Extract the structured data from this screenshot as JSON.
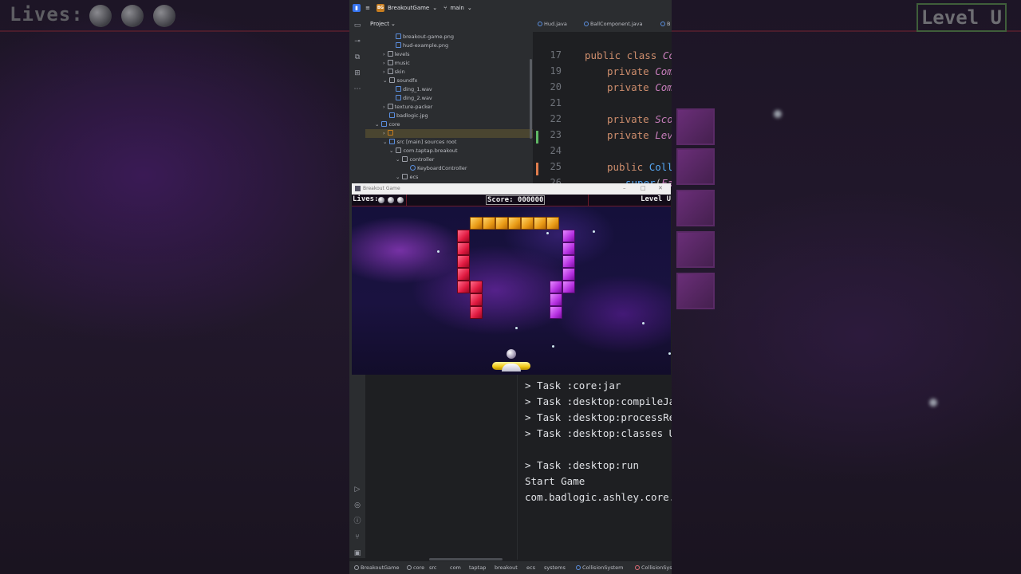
{
  "background": {
    "lives_label": "Lives:",
    "level_label": "Level U"
  },
  "ide": {
    "project_name": "BreakoutGame",
    "project_badge": "BG",
    "branch": "main",
    "project_panel_title": "Project",
    "tree": [
      {
        "label": "breakout-game.png",
        "kind": "file"
      },
      {
        "label": "hud-example.png",
        "kind": "file"
      },
      {
        "label": "levels",
        "kind": "folder"
      },
      {
        "label": "music",
        "kind": "folder"
      },
      {
        "label": "skin",
        "kind": "folder"
      },
      {
        "label": "soundfx",
        "kind": "folder"
      },
      {
        "label": "ding_1.wav",
        "kind": "file"
      },
      {
        "label": "ding_2.wav",
        "kind": "file"
      },
      {
        "label": "texture-packer",
        "kind": "folder"
      },
      {
        "label": "badlogic.jpg",
        "kind": "file"
      },
      {
        "label": "core",
        "kind": "folder"
      },
      {
        "label": "",
        "kind": "folder"
      },
      {
        "label": "src [main] sources root",
        "kind": "folder"
      },
      {
        "label": "com.taptap.breakout",
        "kind": "package"
      },
      {
        "label": "controller",
        "kind": "folder"
      },
      {
        "label": "KeyboardController",
        "kind": "file"
      },
      {
        "label": "ecs",
        "kind": "folder"
      }
    ],
    "tabs": [
      "Hud.java",
      "BallComponent.java",
      "B"
    ],
    "code_lines": [
      {
        "num": "17",
        "parts": [
          {
            "t": "public class ",
            "c": "kw"
          },
          {
            "t": "Coll",
            "c": "ty"
          }
        ]
      },
      {
        "num": "19",
        "parts": [
          {
            "t": "private ",
            "c": "kw"
          },
          {
            "t": "Comp",
            "c": "ty"
          }
        ]
      },
      {
        "num": "20",
        "parts": [
          {
            "t": "private ",
            "c": "kw"
          },
          {
            "t": "Comp",
            "c": "ty"
          }
        ]
      },
      {
        "num": "21",
        "parts": []
      },
      {
        "num": "22",
        "parts": [
          {
            "t": "private ",
            "c": "kw"
          },
          {
            "t": "Scor",
            "c": "ty"
          }
        ]
      },
      {
        "num": "23",
        "parts": [
          {
            "t": "private ",
            "c": "kw"
          },
          {
            "t": "Leve",
            "c": "ty"
          }
        ]
      },
      {
        "num": "24",
        "parts": []
      },
      {
        "num": "25",
        "parts": [
          {
            "t": "public ",
            "c": "kw"
          },
          {
            "t": "Colli",
            "c": "fn"
          }
        ]
      },
      {
        "num": "26",
        "parts": [
          {
            "t": "super",
            "c": "fn"
          },
          {
            "t": "(",
            "c": ""
          },
          {
            "t": "Fam",
            "c": "ty"
          }
        ]
      }
    ],
    "console_lines": [
      "> Task :core:jar",
      "> Task :desktop:compileJava",
      "> Task :desktop:processReso",
      "> Task :desktop:classes UP-",
      "",
      "> Task :desktop:run",
      "Start Game",
      "com.badlogic.ashley.core.Po"
    ],
    "breadcrumb": [
      "BreakoutGame",
      "core",
      "src",
      "com",
      "taptap",
      "breakout",
      "ecs",
      "systems",
      "CollisionSystem",
      "CollisionSys"
    ]
  },
  "game": {
    "window_title": "Breakout Game",
    "lives_label": "Lives:",
    "lives_count": 3,
    "score_label": "Score: 000000",
    "level_label": "Level U"
  }
}
